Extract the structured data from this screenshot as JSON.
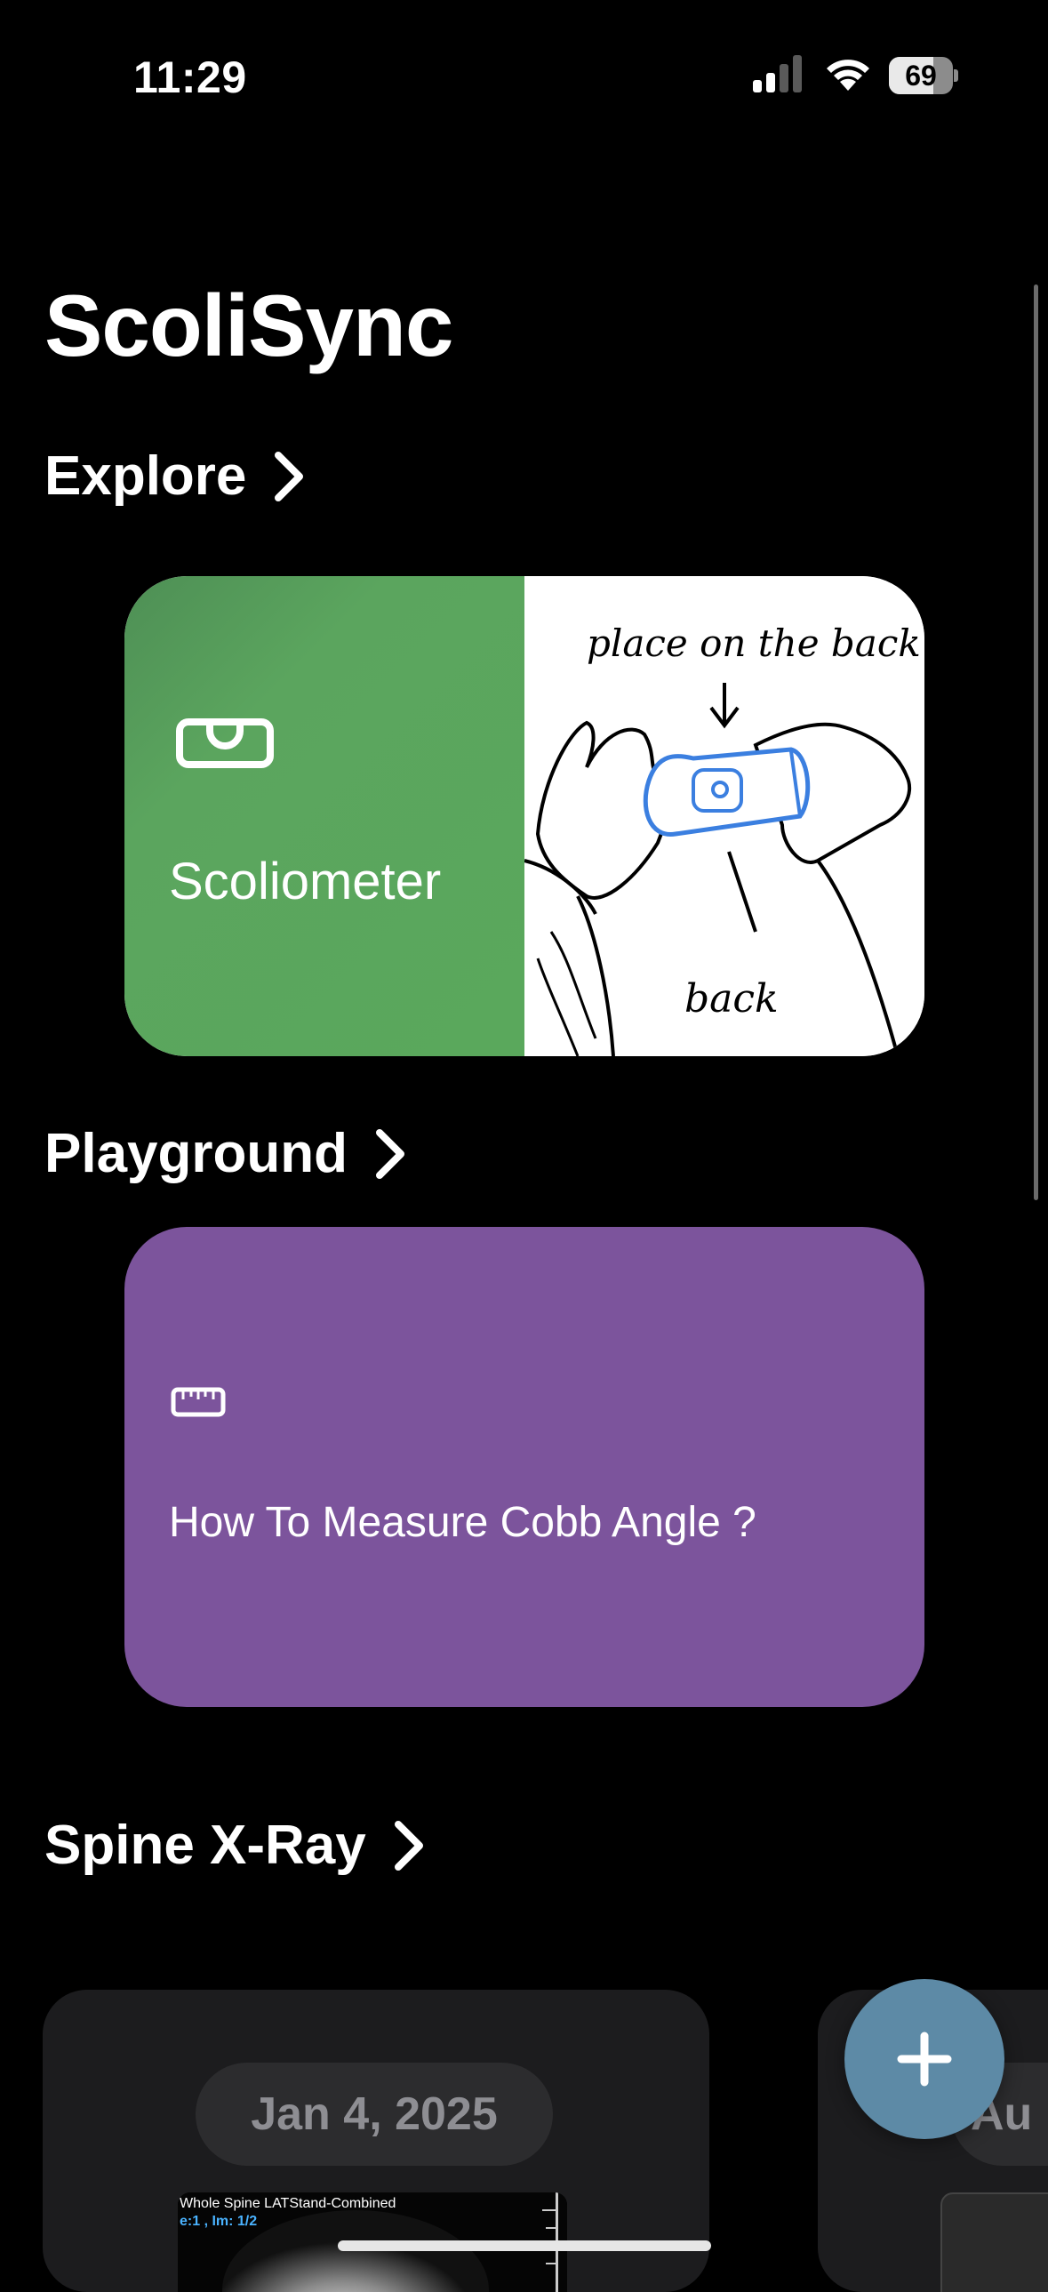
{
  "status_bar": {
    "time": "11:29",
    "battery_level": "69",
    "battery_fraction": 0.69
  },
  "app": {
    "title": "ScoliSync"
  },
  "sections": {
    "explore": {
      "label": "Explore"
    },
    "playground": {
      "label": "Playground"
    },
    "spine_xray": {
      "label": "Spine X-Ray"
    }
  },
  "cards": {
    "scoliometer": {
      "label": "Scoliometer",
      "icon": "level-icon",
      "illustration_text": [
        "place on the back",
        "back"
      ],
      "color": "#5aa85c"
    },
    "cobb": {
      "label": "How To Measure Cobb Angle ?",
      "icon": "ruler-icon",
      "color": "#7c549c"
    }
  },
  "xray_list": [
    {
      "date": "Jan 4, 2025",
      "caption": "Whole Spine LATStand-Combined",
      "caption2": "e:1 , Im: 1/2"
    },
    {
      "date": "Au"
    }
  ],
  "fab": {
    "icon": "plus-icon",
    "color": "#5d8aa6"
  }
}
